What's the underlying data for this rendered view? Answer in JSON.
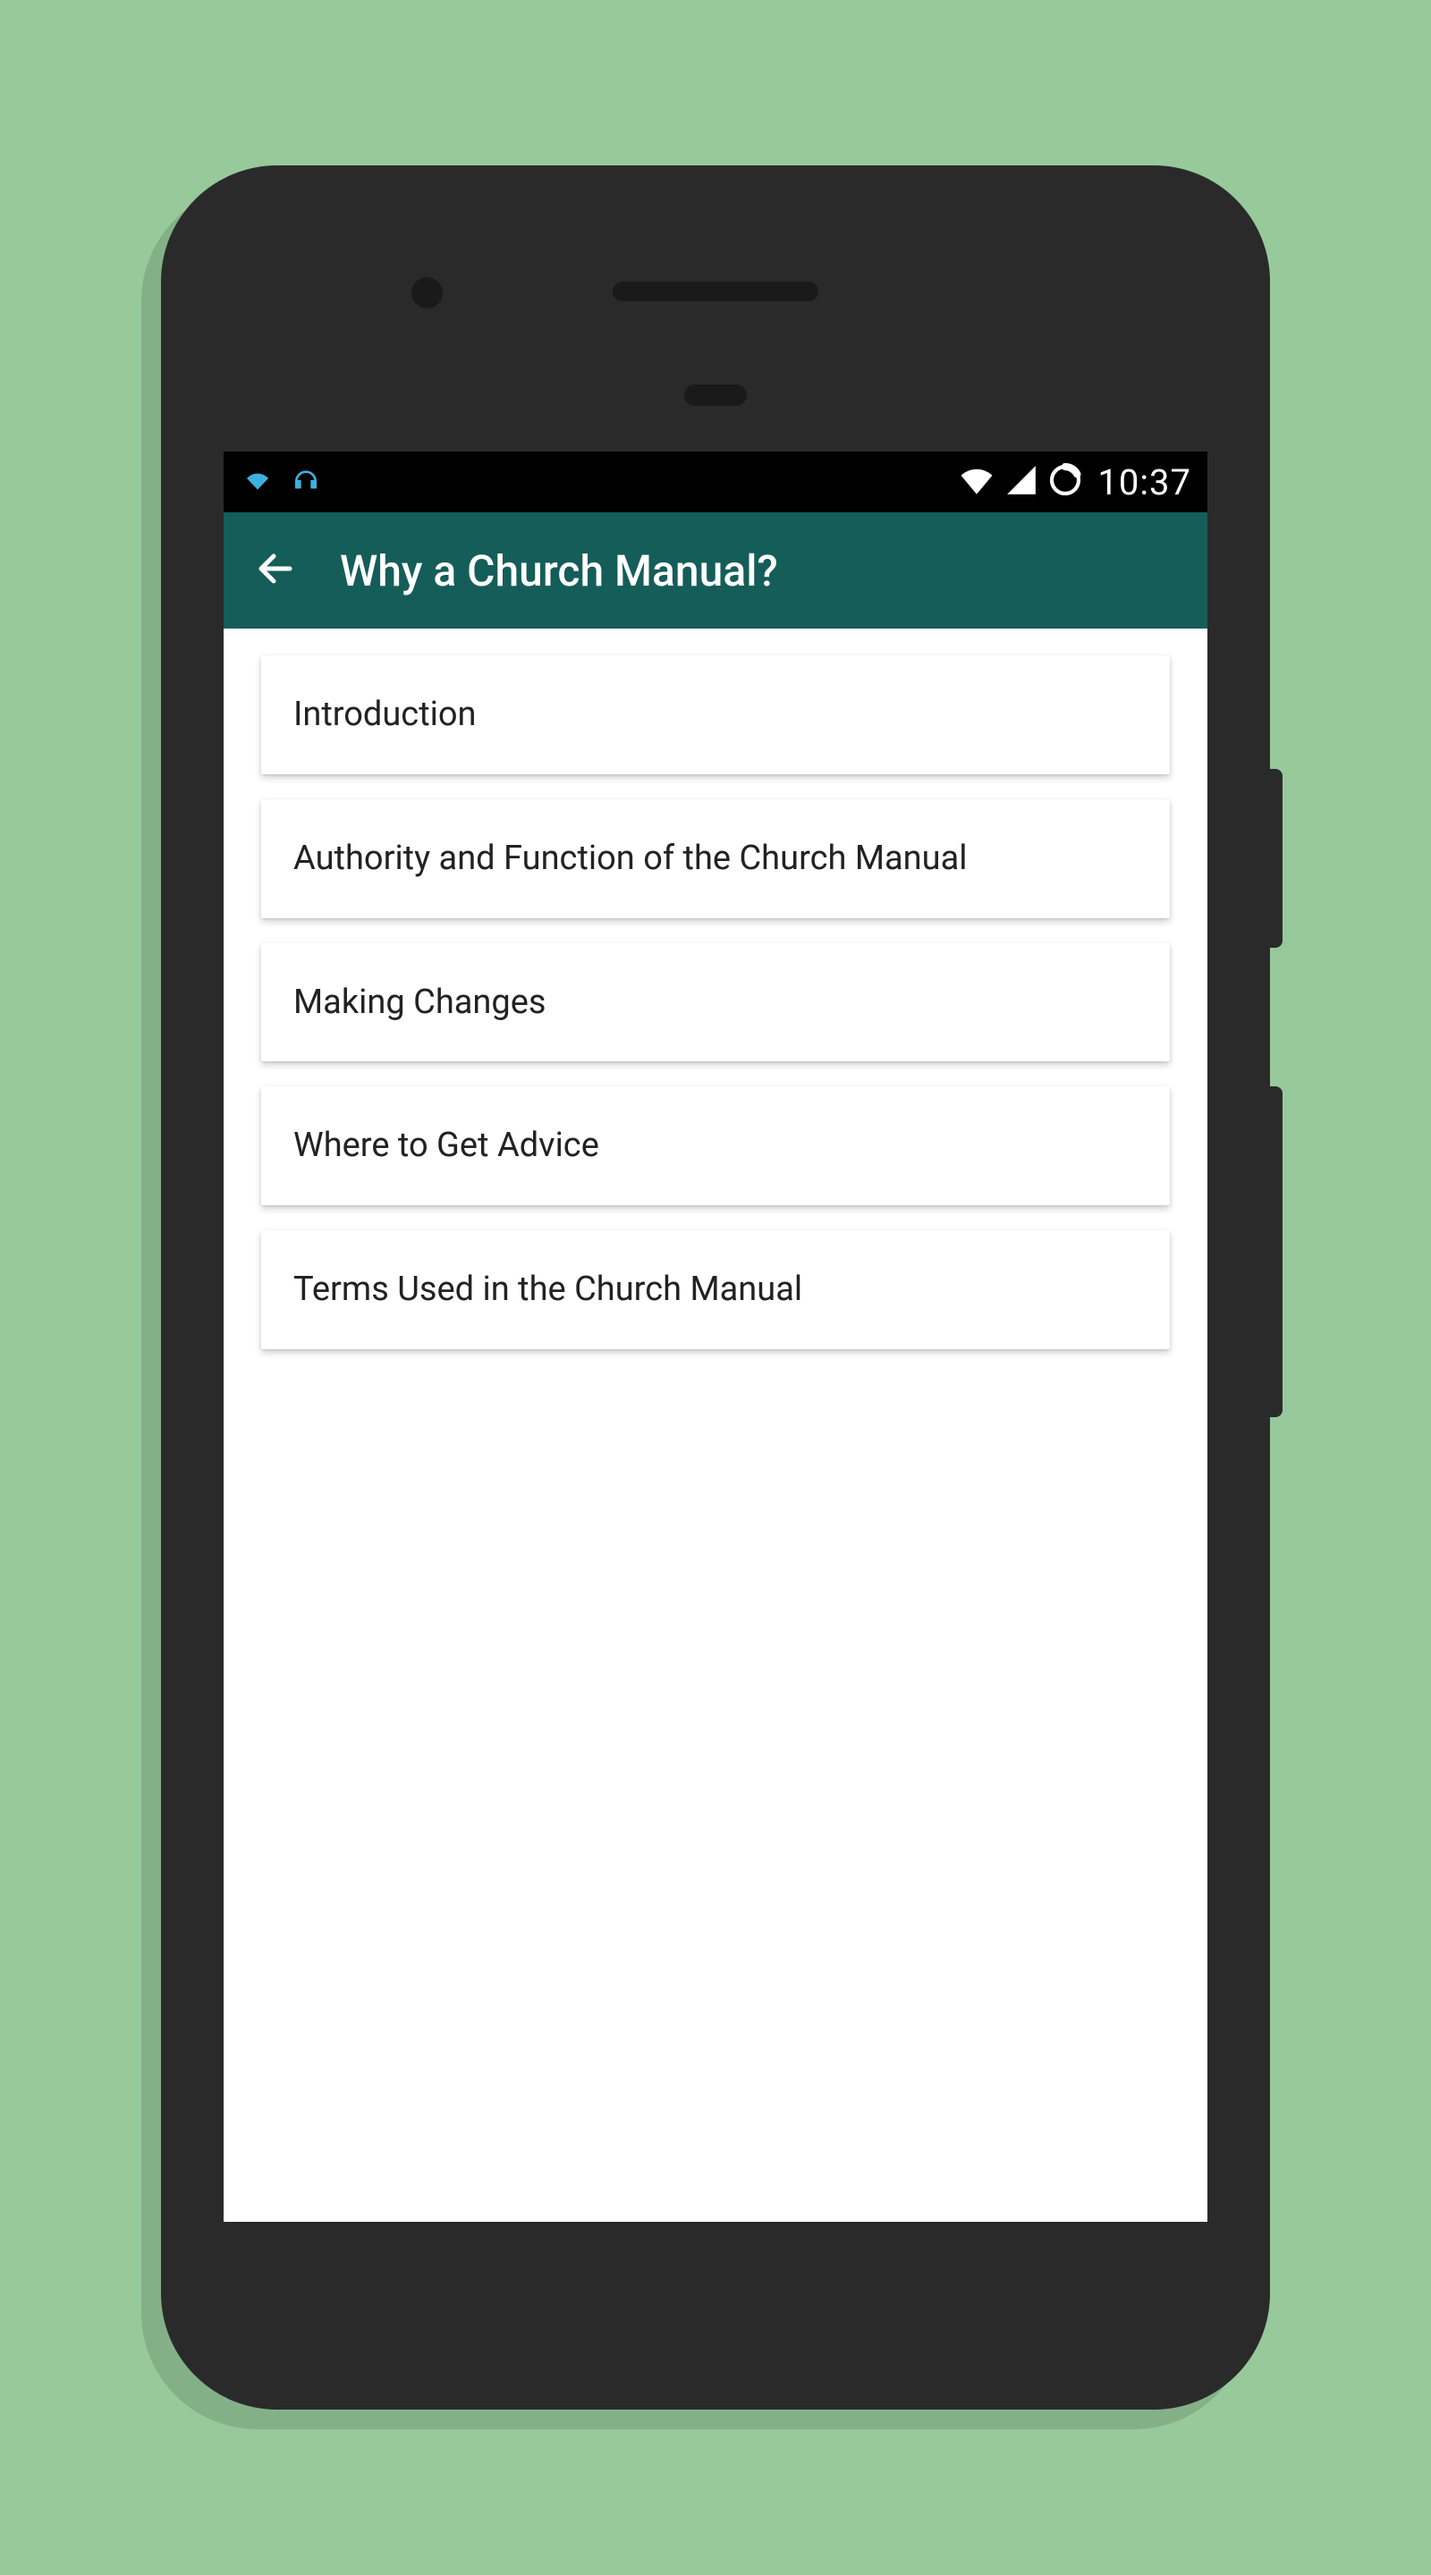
{
  "status_bar": {
    "time": "10:37"
  },
  "app_bar": {
    "title": "Why a Church Manual?"
  },
  "list": {
    "items": [
      {
        "label": "Introduction"
      },
      {
        "label": "Authority and Function of the Church Manual"
      },
      {
        "label": "Making Changes"
      },
      {
        "label": "Where to Get Advice"
      },
      {
        "label": "Terms Used in the Church Manual"
      }
    ]
  },
  "colors": {
    "background": "#97c99b",
    "phone_body": "#2a2a2a",
    "app_bar_bg": "#155d59",
    "status_bar_bg": "#000000",
    "status_icon_blue": "#3db0e0",
    "text": "#222222"
  }
}
